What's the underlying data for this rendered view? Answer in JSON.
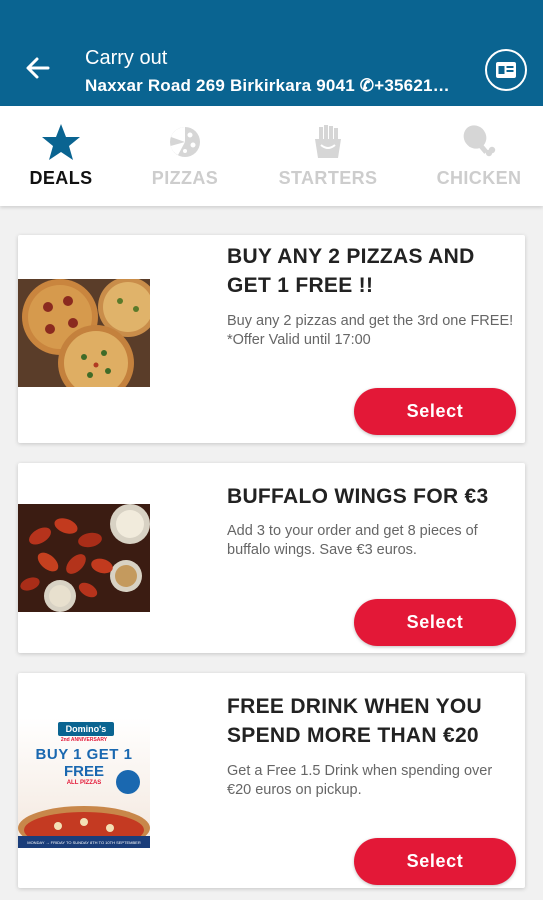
{
  "header": {
    "title": "Carry out",
    "subtitle": "Naxxar Road 269 Birkirkara 9041 ✆+35621…"
  },
  "tabs": [
    {
      "label": "DEALS",
      "icon": "star-icon",
      "active": true
    },
    {
      "label": "PIZZAS",
      "icon": "pizza-icon",
      "active": false
    },
    {
      "label": "STARTERS",
      "icon": "fries-icon",
      "active": false
    },
    {
      "label": "CHICKEN",
      "icon": "drumstick-icon",
      "active": false
    }
  ],
  "deals": [
    {
      "title": "BUY ANY 2 PIZZAS AND GET 1 FREE !!",
      "description": "Buy any 2 pizzas and get the 3rd one FREE! *Offer Valid until 17:00",
      "button": "Select"
    },
    {
      "title": "BUFFALO WINGS FOR €3",
      "description": "Add 3 to your order and get 8 pieces of buffalo wings. Save €3 euros.",
      "button": "Select"
    },
    {
      "title": "FREE DRINK WHEN YOU SPEND MORE THAN €20",
      "description": "Get a Free 1.5 Drink  when spending over €20 euros on pickup.",
      "button": "Select",
      "poster": {
        "brand": "Domino's",
        "ribbon": "2nd ANNIVERSARY",
        "headline1": "BUY 1 GET 1",
        "headline2": "FREE",
        "sub": "ALL PIZZAS",
        "footer": "MONDAY → FRIDAY TO SUNDAY 8TH TO 10TH SEPTEMBER"
      }
    }
  ],
  "colors": {
    "header": "#0a6491",
    "accent": "#e31837",
    "active_tab": "#0a6491",
    "inactive_tab": "#cdcdcd"
  }
}
